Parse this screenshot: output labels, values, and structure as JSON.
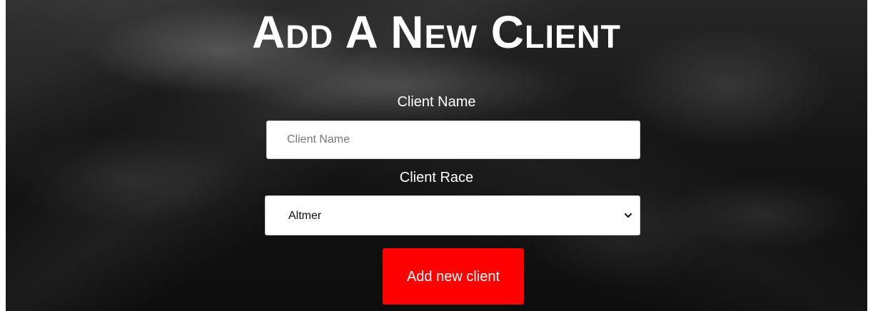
{
  "header": {
    "title": "Add A New Client"
  },
  "form": {
    "client_name": {
      "label": "Client Name",
      "placeholder": "Client Name",
      "value": ""
    },
    "client_race": {
      "label": "Client Race",
      "selected": "Altmer"
    },
    "submit_label": "Add new client"
  },
  "icons": {
    "select_arrow": "chevron-down-icon"
  },
  "colors": {
    "button": "#ff0000",
    "text": "#ffffff",
    "field_background": "#ffffff"
  }
}
